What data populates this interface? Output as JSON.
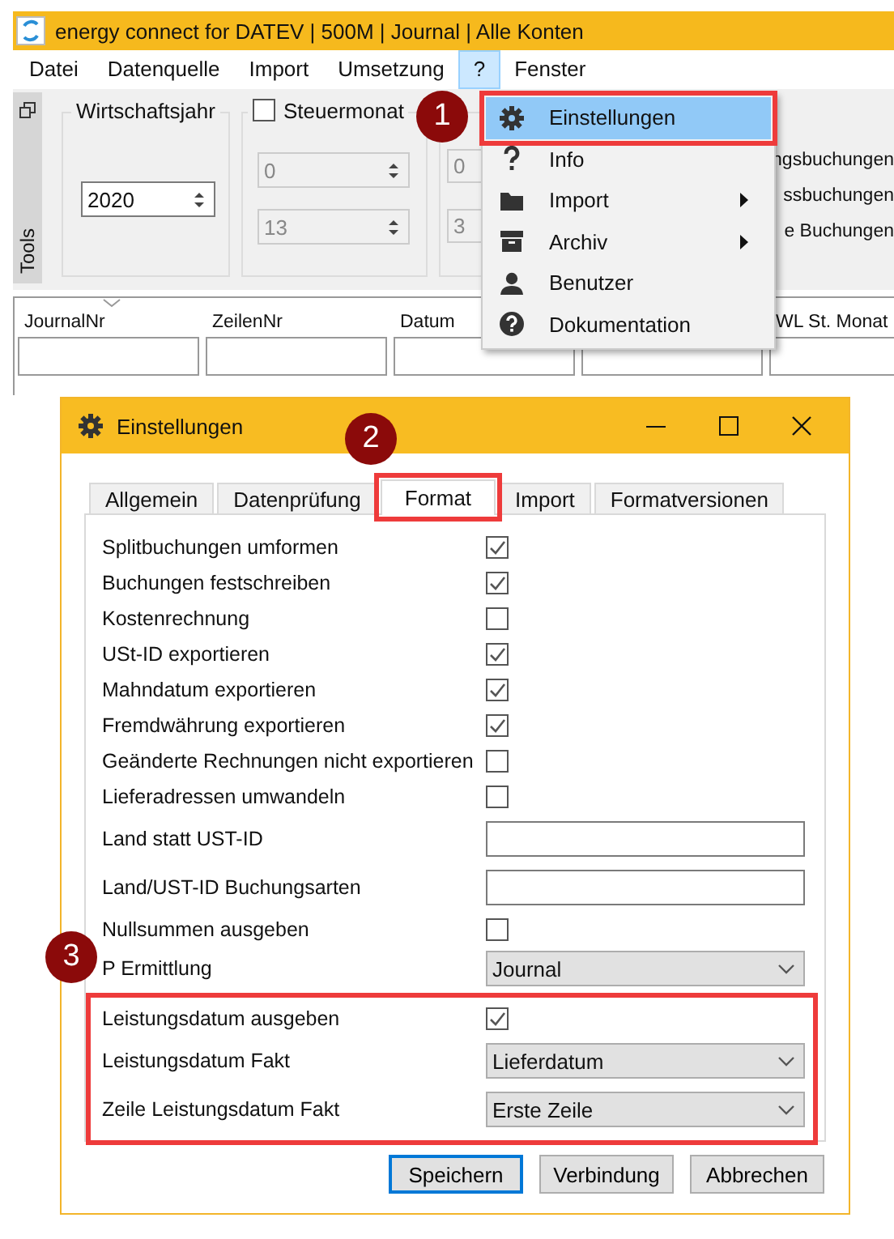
{
  "window": {
    "title": "energy connect for DATEV | 500M | Journal | Alle Konten"
  },
  "menu_bar": [
    {
      "label": "Datei",
      "selected": false
    },
    {
      "label": "Datenquelle",
      "selected": false
    },
    {
      "label": "Import",
      "selected": false
    },
    {
      "label": "Umsetzung",
      "selected": false
    },
    {
      "label": "?",
      "selected": true
    },
    {
      "label": "Fenster",
      "selected": false
    }
  ],
  "toolbar": {
    "panel_label": "Tools",
    "fiscal_year": {
      "label": "Wirtschaftsjahr",
      "value": "2020"
    },
    "tax_month": {
      "label": "Steuermonat",
      "checked": false,
      "from": "0",
      "to": "13"
    },
    "partial_spinners": [
      "0",
      "3"
    ],
    "partial_options": [
      "ngsbuchungen",
      "ssbuchungen",
      "e Buchungen"
    ]
  },
  "table": {
    "columns": [
      {
        "label": "JournalNr",
        "sort_indicator": true
      },
      {
        "label": "ZeilenNr"
      },
      {
        "label": "Datum"
      },
      {},
      {
        "label": "WL St. Monat"
      }
    ]
  },
  "dropdown_menu": {
    "items": [
      {
        "label": "Einstellungen",
        "selected": true,
        "submenu": false,
        "highlighted": true
      },
      {
        "label": "Info",
        "selected": false,
        "submenu": false,
        "highlighted": false
      },
      {
        "label": "Import",
        "selected": false,
        "submenu": true,
        "highlighted": false
      },
      {
        "label": "Archiv",
        "selected": false,
        "submenu": true,
        "highlighted": false
      },
      {
        "label": "Benutzer",
        "selected": false,
        "submenu": false,
        "highlighted": false
      },
      {
        "label": "Dokumentation",
        "selected": false,
        "submenu": false,
        "highlighted": false
      }
    ]
  },
  "dialog": {
    "title": "Einstellungen",
    "tabs": [
      {
        "label": "Allgemein",
        "selected": false,
        "highlighted": false
      },
      {
        "label": "Datenprüfung",
        "selected": false,
        "highlighted": false
      },
      {
        "label": "Format",
        "selected": true,
        "highlighted": true
      },
      {
        "label": "Import",
        "selected": false,
        "highlighted": false
      },
      {
        "label": "Formatversionen",
        "selected": false,
        "highlighted": false
      }
    ],
    "rows": [
      {
        "kind": "checkbox",
        "label": "Splitbuchungen umformen",
        "checked": true,
        "highlighted": false
      },
      {
        "kind": "checkbox",
        "label": "Buchungen festschreiben",
        "checked": true,
        "highlighted": false
      },
      {
        "kind": "checkbox",
        "label": "Kostenrechnung",
        "checked": false,
        "highlighted": false
      },
      {
        "kind": "checkbox",
        "label": "USt-ID exportieren",
        "checked": true,
        "highlighted": false
      },
      {
        "kind": "checkbox",
        "label": "Mahndatum exportieren",
        "checked": true,
        "highlighted": false
      },
      {
        "kind": "checkbox",
        "label": "Fremdwährung exportieren",
        "checked": true,
        "highlighted": false
      },
      {
        "kind": "checkbox",
        "label": "Geänderte Rechnungen nicht exportieren",
        "checked": false,
        "highlighted": false
      },
      {
        "kind": "checkbox",
        "label": "Lieferadressen umwandeln",
        "checked": false,
        "highlighted": false
      },
      {
        "kind": "text",
        "label": "Land statt UST-ID",
        "highlighted": false
      },
      {
        "kind": "text",
        "label": "Land/UST-ID Buchungsarten",
        "highlighted": false
      },
      {
        "kind": "checkbox",
        "label": "Nullsummen ausgeben",
        "checked": false,
        "highlighted": false
      },
      {
        "kind": "select",
        "label": "P Ermittlung",
        "value": "Journal",
        "highlighted": false
      },
      {
        "kind": "checkbox",
        "label": "Leistungsdatum ausgeben",
        "checked": true,
        "highlighted": true
      },
      {
        "kind": "select",
        "label": "Leistungsdatum Fakt",
        "value": "Lieferdatum",
        "highlighted": true
      },
      {
        "kind": "select",
        "label": "Zeile Leistungsdatum Fakt",
        "value": "Erste Zeile",
        "highlighted": true
      }
    ],
    "buttons": [
      {
        "label": "Speichern",
        "default": true
      },
      {
        "label": "Verbindung",
        "default": false
      },
      {
        "label": "Abbrechen",
        "default": false
      }
    ]
  },
  "callouts": [
    "1",
    "2",
    "3"
  ]
}
